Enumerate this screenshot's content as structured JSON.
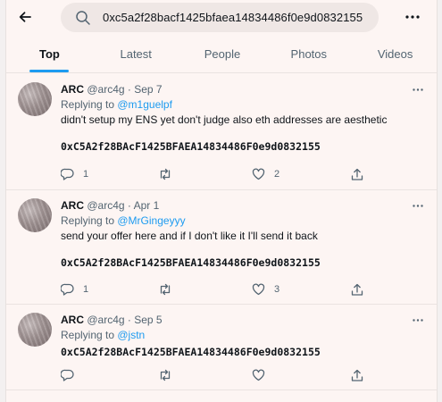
{
  "search": {
    "query": "0xc5a2f28bacf1425bfaea14834486f0e9d0832155"
  },
  "tabs": [
    {
      "label": "Top",
      "active": true
    },
    {
      "label": "Latest",
      "active": false
    },
    {
      "label": "People",
      "active": false
    },
    {
      "label": "Photos",
      "active": false
    },
    {
      "label": "Videos",
      "active": false
    }
  ],
  "tweets": [
    {
      "name": "ARC",
      "handle": "@arc4g",
      "dot": "·",
      "date": "Sep 7",
      "replying_prefix": "Replying to ",
      "replying_to": "@m1guelpf",
      "text": "didn't setup my ENS yet don't judge also eth addresses are aesthetic",
      "address": "0xC5A2f28BAcF1425BFAEA14834486F0e9d0832155",
      "replies": "1",
      "retweets": "",
      "likes": "2"
    },
    {
      "name": "ARC",
      "handle": "@arc4g",
      "dot": "·",
      "date": "Apr 1",
      "replying_prefix": "Replying to ",
      "replying_to": "@MrGingeyyy",
      "text": "send your offer here and if I don't like it I'll send it back",
      "address": "0xC5A2f28BAcF1425BFAEA14834486F0e9d0832155",
      "replies": "1",
      "retweets": "",
      "likes": "3"
    },
    {
      "name": "ARC",
      "handle": "@arc4g",
      "dot": "·",
      "date": "Sep 5",
      "replying_prefix": "Replying to ",
      "replying_to": "@jstn",
      "text": "",
      "address": "0xC5A2f28BAcF1425BFAEA14834486F0e9d0832155",
      "replies": "",
      "retweets": "",
      "likes": ""
    }
  ],
  "colors": {
    "accent": "#1d9bf0",
    "background": "#fdf5f3",
    "secondary_text": "#536471"
  },
  "icons": [
    "back-arrow-icon",
    "search-icon",
    "more-icon",
    "reply-icon",
    "retweet-icon",
    "like-icon",
    "share-icon"
  ]
}
